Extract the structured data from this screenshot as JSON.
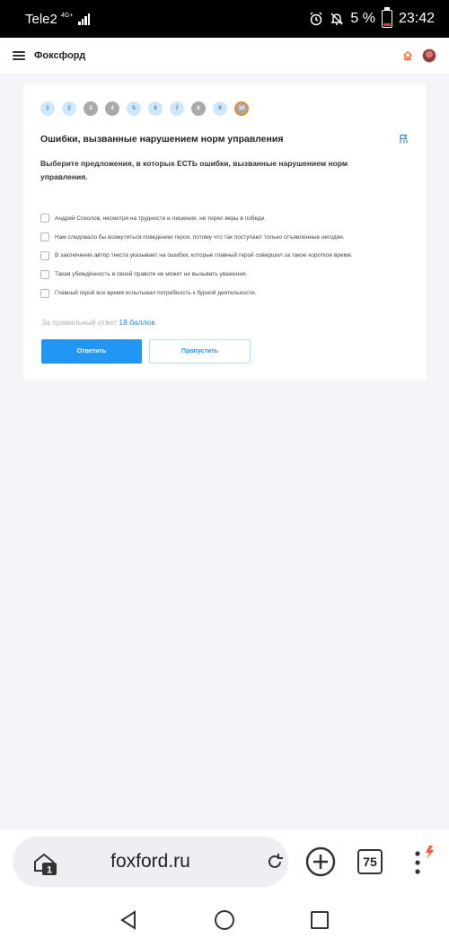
{
  "status_bar": {
    "carrier": "Tele2",
    "network": "4G+",
    "battery_percent": "5 %",
    "time": "23:42"
  },
  "header": {
    "brand": "Фоксфорд"
  },
  "quiz": {
    "steps": [
      {
        "label": "1",
        "state": "answered"
      },
      {
        "label": "2",
        "state": "answered"
      },
      {
        "label": "3",
        "state": "skipped"
      },
      {
        "label": "4",
        "state": "skipped"
      },
      {
        "label": "5",
        "state": "answered"
      },
      {
        "label": "6",
        "state": "answered"
      },
      {
        "label": "7",
        "state": "answered"
      },
      {
        "label": "8",
        "state": "skipped"
      },
      {
        "label": "9",
        "state": "answered"
      },
      {
        "label": "10",
        "state": "current"
      }
    ],
    "title": "Ошибки, вызванные нарушением норм управления",
    "question": "Выберите предложения, в которых ЕСТЬ ошибки, вызванные нарушением норм управления.",
    "options": [
      "Андрей Соколов, несмотря на трудности и лишения, не терял веры в победе.",
      "Нам следовало бы возмутиться поведению героя, потому что так поступают только отъявленные негодяи.",
      "В заключение автор текста указывает на ошибки, которые главный герой совершил за такое короткое время.",
      "Такая убеждённость в своей правоте не может не вызывать уважения.",
      "Главный герой все время испытывал потребность к бурной деятельности."
    ],
    "points_label": "За правильный ответ",
    "points_value": "18 баллов",
    "answer_button": "Ответить",
    "skip_button": "Пропустить"
  },
  "browser": {
    "url": "foxford.ru",
    "tab_badge": "1",
    "tabs_count": "75"
  },
  "colors": {
    "accent": "#2196f3",
    "brand_orange": "#ff6b2c",
    "step_answered": "#cfe7fb",
    "step_skipped": "#a9a9a9"
  }
}
